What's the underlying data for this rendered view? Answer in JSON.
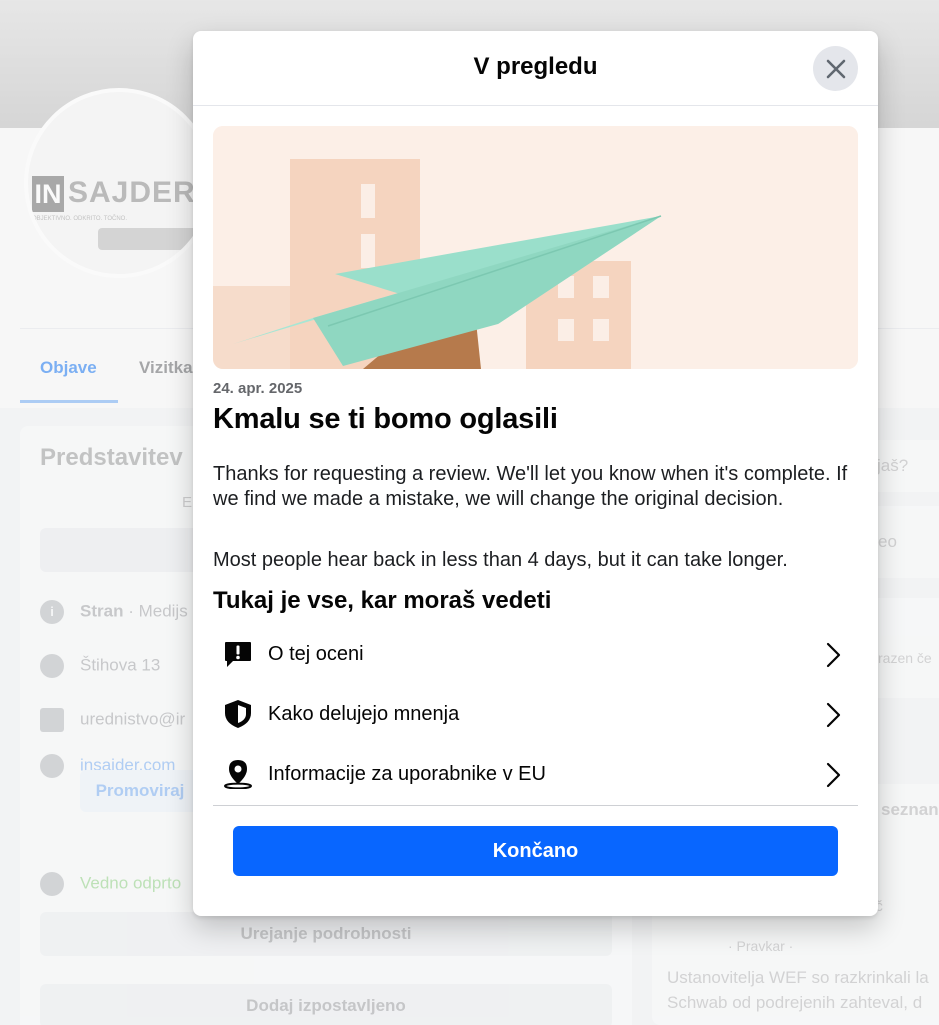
{
  "background": {
    "logo_box": "IN",
    "logo_text": "SAJDER",
    "logo_sub": "OBJEKTIVNO. ODKRITO. TOČNO.",
    "tabs": [
      {
        "label": "Objave"
      },
      {
        "label": "Vizitka"
      }
    ],
    "intro_title": "Predstavitev",
    "intro_sub": "E",
    "info": {
      "page_label": "Stran",
      "page_category": " · Medijs",
      "address": "Štihova 13",
      "email": "urednistvo@ir",
      "website": "insajder.com",
      "hours": "Vedno odprto"
    },
    "promote_label": "Promoviraj",
    "edit_details_label": "Urejanje podrobnosti",
    "add_featured_label": "Dodaj izpostavljeno",
    "right": {
      "question": "jaš?",
      "video": "eo",
      "shared": "razen če",
      "list_link": "seznan",
      "name_tail": "ič",
      "meta": "· Pravkar ·",
      "post_line1": "Ustanovitelja WEF so razkrinkali la",
      "post_line2": "Schwab od podrejenih zahteval, d"
    }
  },
  "modal": {
    "title": "V pregledu",
    "date": "24. apr. 2025",
    "headline": "Kmalu se ti bomo oglasili",
    "paragraph1": "Thanks for requesting a review. We'll let you know when it's complete. If we find we made a mistake, we will change the original decision.",
    "paragraph2": "Most people hear back in less than 4 days, but it can take longer.",
    "section_title": "Tukaj je vse, kar moraš vedeti",
    "items": [
      {
        "label": "O tej oceni",
        "icon": "alert-message-icon"
      },
      {
        "label": "Kako delujejo mnenja",
        "icon": "shield-icon"
      },
      {
        "label": "Informacije za uporabnike v EU",
        "icon": "location-pin-icon"
      }
    ],
    "done_label": "Končano"
  },
  "colors": {
    "primary_button": "#0866ff",
    "hero_background": "#fbeee6",
    "paper_plane": "#9fe0cd",
    "building": "#f5d4bf"
  }
}
